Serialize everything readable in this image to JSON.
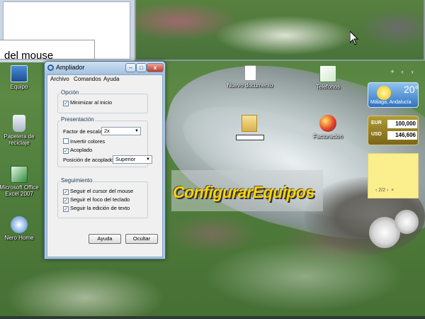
{
  "desktop": {
    "icons": [
      {
        "label": "Equipo",
        "name": "desktop-icon-equipo"
      },
      {
        "label": "Papelera de reciclaje",
        "name": "desktop-icon-papelera"
      },
      {
        "label": "Microsoft Office Excel 2007",
        "name": "desktop-icon-excel"
      },
      {
        "label": "Nero Home",
        "name": "desktop-icon-nero"
      },
      {
        "label": "Nuevo documento",
        "name": "desktop-icon-nuevo-documento"
      },
      {
        "label": "Telefonos",
        "name": "desktop-icon-telefonos"
      },
      {
        "label": "Facturacion",
        "name": "desktop-icon-facturacion"
      }
    ]
  },
  "background_window": {
    "text": "del mouse"
  },
  "watermark": {
    "text": "ConfigurarEquipos"
  },
  "sidebar": {
    "controls": [
      "+",
      "‹",
      "›"
    ],
    "weather": {
      "temp": "20°",
      "city": "Málaga, Andalucía"
    },
    "currency": [
      {
        "label": "EUR",
        "value": "100,000"
      },
      {
        "label": "USD",
        "value": "146,606"
      }
    ],
    "notes": {
      "pager": "2/2"
    }
  },
  "ampliador": {
    "title": "Ampliador",
    "window_buttons": {
      "minimize": "–",
      "maximize": "□",
      "close": "x"
    },
    "menu": [
      "Archivo",
      "Comandos",
      "Ayuda"
    ],
    "opcion": {
      "label": "Opción",
      "minimizar": {
        "label": "Minimizar al inicio",
        "checked": true
      }
    },
    "presentacion": {
      "label": "Presentación",
      "factor_label": "Factor de escala:",
      "factor_value": "2x",
      "invertir": {
        "label": "Invertir colores",
        "checked": false
      },
      "acoplado": {
        "label": "Acoplado",
        "checked": true
      },
      "posicion_label": "Posición de acoplado:",
      "posicion_value": "Superior"
    },
    "seguimiento": {
      "label": "Seguimiento",
      "items": [
        {
          "label": "Seguir el cursor del mouse",
          "checked": true
        },
        {
          "label": "Seguir el foco del teclado",
          "checked": true
        },
        {
          "label": "Seguir la edición de texto",
          "checked": true
        }
      ]
    },
    "buttons": {
      "ayuda": "Ayuda",
      "ocultar": "Ocultar"
    }
  }
}
